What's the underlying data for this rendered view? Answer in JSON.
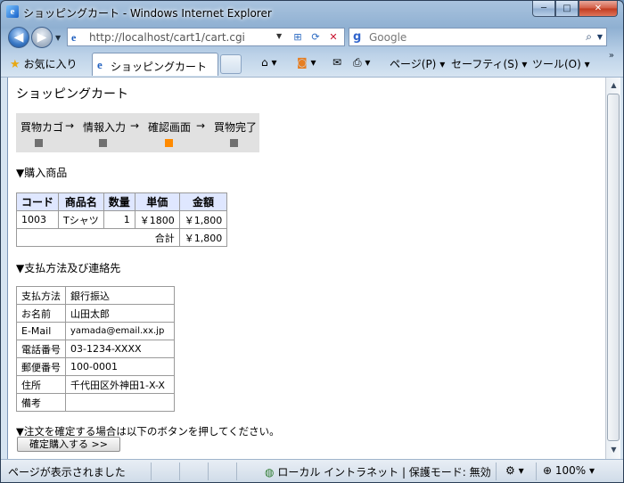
{
  "window": {
    "title": "ショッピングカート - Windows Internet Explorer",
    "min_glyph": "─",
    "max_glyph": "□",
    "close_glyph": "✕"
  },
  "nav": {
    "back_glyph": "◀",
    "forward_glyph": "▶",
    "address": "http://localhost/cart1/cart.cgi",
    "search_provider": "Google"
  },
  "toolbar": {
    "favorites": "お気に入り",
    "tab_label": "ショッピングカート",
    "page_menu": "ページ(P)",
    "safety_menu": "セーフティ(S)",
    "tools_menu": "ツール(O)"
  },
  "page": {
    "title": "ショッピングカート",
    "steps": [
      "買物カゴ",
      "→",
      "情報入力",
      "→",
      "確認画面",
      "→",
      "買物完了"
    ],
    "current_step": 2,
    "section_items": "▼購入商品",
    "items_headers": [
      "コード",
      "商品名",
      "数量",
      "単価",
      "金額"
    ],
    "items_rows": [
      [
        "1003",
        "Tシャツ",
        "1",
        "￥1800",
        "￥1,800"
      ]
    ],
    "total_label": "合計",
    "total_value": "￥1,800",
    "section_contact": "▼支払方法及び連絡先",
    "contact": [
      [
        "支払方法",
        "銀行振込"
      ],
      [
        "お名前",
        "山田太郎"
      ],
      [
        "E-Mail",
        "yamada@email.xx.jp"
      ],
      [
        "電話番号",
        "03-1234-XXXX"
      ],
      [
        "郵便番号",
        "100-0001"
      ],
      [
        "住所",
        "千代田区外神田1-X-X"
      ],
      [
        "備考",
        ""
      ]
    ],
    "confirm_note": "▼注文を確定する場合は以下のボタンを押してください。",
    "confirm_button": "確定購入する >>"
  },
  "status": {
    "text": "ページが表示されました",
    "zone": "ローカル イントラネット | 保護モード: 無効",
    "zoom": "100%"
  },
  "colors": {
    "active_step": "#ff8a00",
    "inactive_step": "#707070",
    "table_header_bg": "#dfe7ff"
  }
}
